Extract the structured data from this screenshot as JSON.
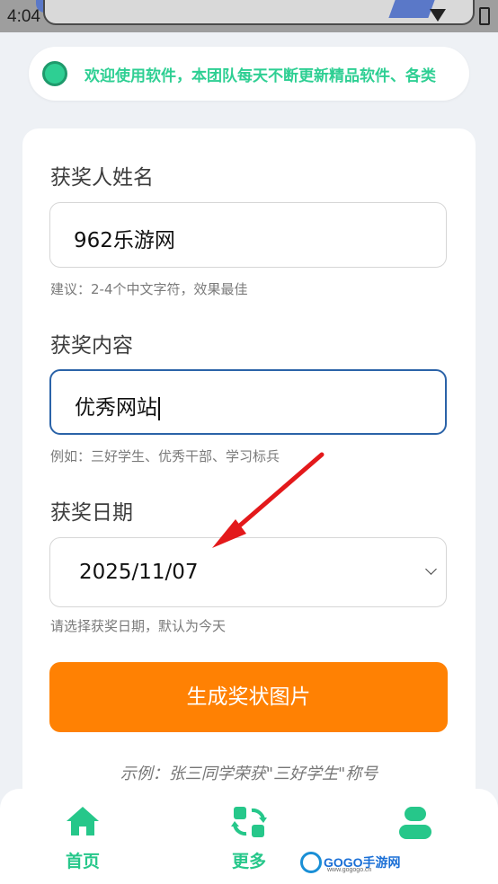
{
  "status_bar": {
    "time": "4:04"
  },
  "notice": {
    "text": "欢迎使用软件，本团队每天不断更新精品软件、各类"
  },
  "form": {
    "name_label": "获奖人姓名",
    "name_value": "962乐游网",
    "name_hint": "建议：2-4个中文字符，效果最佳",
    "content_label": "获奖内容",
    "content_value": "优秀网站",
    "content_hint": "例如：三好学生、优秀干部、学习标兵",
    "date_label": "获奖日期",
    "date_value": "2025/11/07",
    "date_hint": "请选择获奖日期，默认为今天",
    "generate_button": "生成奖状图片",
    "example": "示例：张三同学荣获\"三好学生\"称号"
  },
  "bottom_nav": {
    "items": [
      {
        "label": "首页",
        "icon": "home-icon"
      },
      {
        "label": "更多",
        "icon": "refresh-icon"
      },
      {
        "label": "",
        "icon": "user-icon"
      }
    ]
  },
  "watermark": {
    "brand": "GOGO手游网",
    "url": "www.gogogo.cn"
  },
  "colors": {
    "accent_green": "#26c78a",
    "button_orange": "#ff8103",
    "focus_blue": "#2b63a8",
    "annotation_red": "#e3191b"
  }
}
